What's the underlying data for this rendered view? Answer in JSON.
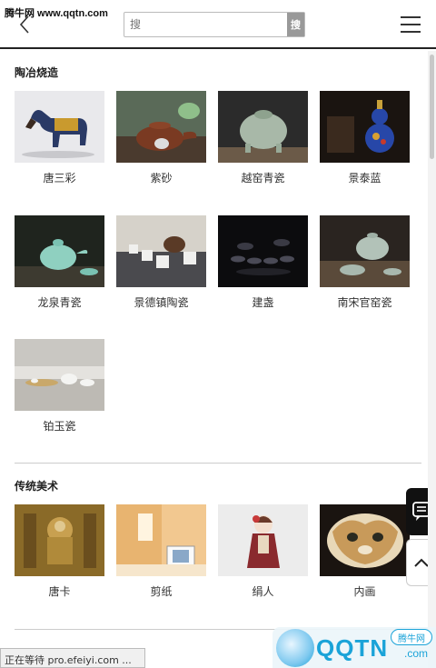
{
  "header": {
    "watermark": "腾牛网 www.qqtn.com",
    "search_placeholder": "搜",
    "search_button": "搜"
  },
  "sections": [
    {
      "title": "陶冶烧造",
      "items": [
        {
          "label": "唐三彩",
          "icon": "tang-sancai-image"
        },
        {
          "label": "紫砂",
          "icon": "zisha-teapot-image"
        },
        {
          "label": "越窑青瓷",
          "icon": "yueyao-celadon-image"
        },
        {
          "label": "景泰蓝",
          "icon": "cloisonne-image"
        },
        {
          "label": "龙泉青瓷",
          "icon": "longquan-celadon-image"
        },
        {
          "label": "景德镇陶瓷",
          "icon": "jingdezhen-ceramics-image"
        },
        {
          "label": "建盏",
          "icon": "jianzhan-image"
        },
        {
          "label": "南宋官窑瓷",
          "icon": "southern-song-guanyao-image"
        },
        {
          "label": "铂玉瓷",
          "icon": "boyu-porcelain-image"
        }
      ]
    },
    {
      "title": "传统美术",
      "items": [
        {
          "label": "唐卡",
          "icon": "thangka-image"
        },
        {
          "label": "剪纸",
          "icon": "paper-cutting-image"
        },
        {
          "label": "绢人",
          "icon": "silk-figurine-image"
        },
        {
          "label": "内画",
          "icon": "inside-painting-image"
        }
      ]
    }
  ],
  "status_bar": "正在等待 pro.efeiyi.com ...",
  "logo": {
    "text": "QQTN",
    "suffix": ".com",
    "badge": "腾牛网"
  }
}
